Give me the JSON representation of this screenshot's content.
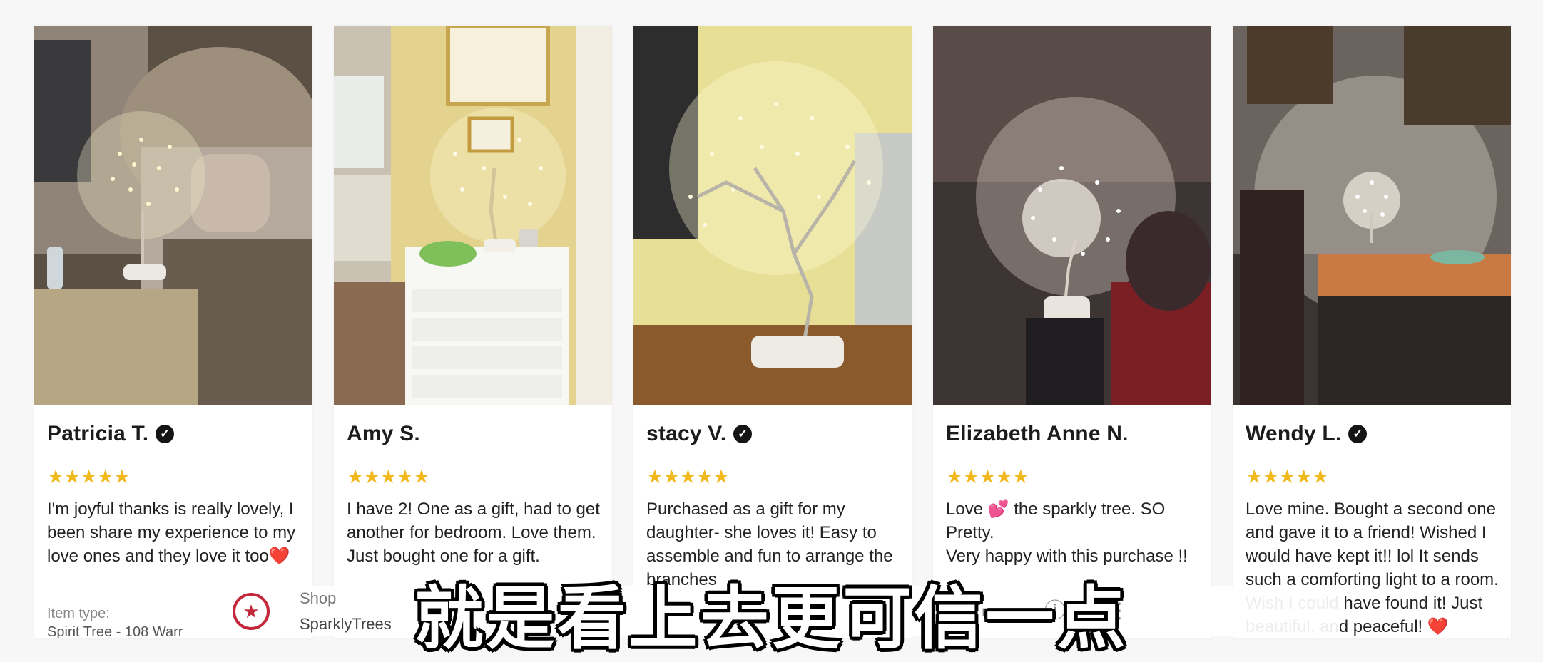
{
  "reviews": [
    {
      "name": "Patricia T.",
      "verified": true,
      "stars": "★★★★★",
      "text": "I'm joyful thanks is really lovely, I been share my experience to my love ones and they love it too❤️",
      "item_label": "Item type:",
      "item_value": "Spirit Tree - 108 Warr"
    },
    {
      "name": "Amy S.",
      "verified": false,
      "stars": "★★★★★",
      "text": "I have 2! One as a gift,  had to get another for bedroom. Love them.  Just bought one for a gift."
    },
    {
      "name": "stacy V.",
      "verified": true,
      "stars": "★★★★★",
      "text": "Purchased as a gift for my daughter- she loves it! Easy to assemble and fun to arrange the branches"
    },
    {
      "name": "Elizabeth Anne N.",
      "verified": false,
      "stars": "★★★★★",
      "text": "Love 💕 the sparkly tree. SO Pretty.\n     Very happy with this purchase !!"
    },
    {
      "name": "Wendy L.",
      "verified": true,
      "stars": "★★★★★",
      "text": "Love mine. Bought a second one and gave it to a friend! Wished I would have kept it!! lol It sends such a comforting light to a room. Wish I could have found it! Just beautiful, and peaceful! ❤️"
    }
  ],
  "shop": {
    "label": "Shop",
    "name": "SparklyTrees"
  },
  "bar_icons": [
    "instagram-icon",
    "folder-icon",
    "help-icon",
    "more-vertical-icon"
  ],
  "subtitle": "就是看上去更可信一点",
  "colors": {
    "star": "#f2b91f",
    "shop_accent": "#c4263a"
  }
}
